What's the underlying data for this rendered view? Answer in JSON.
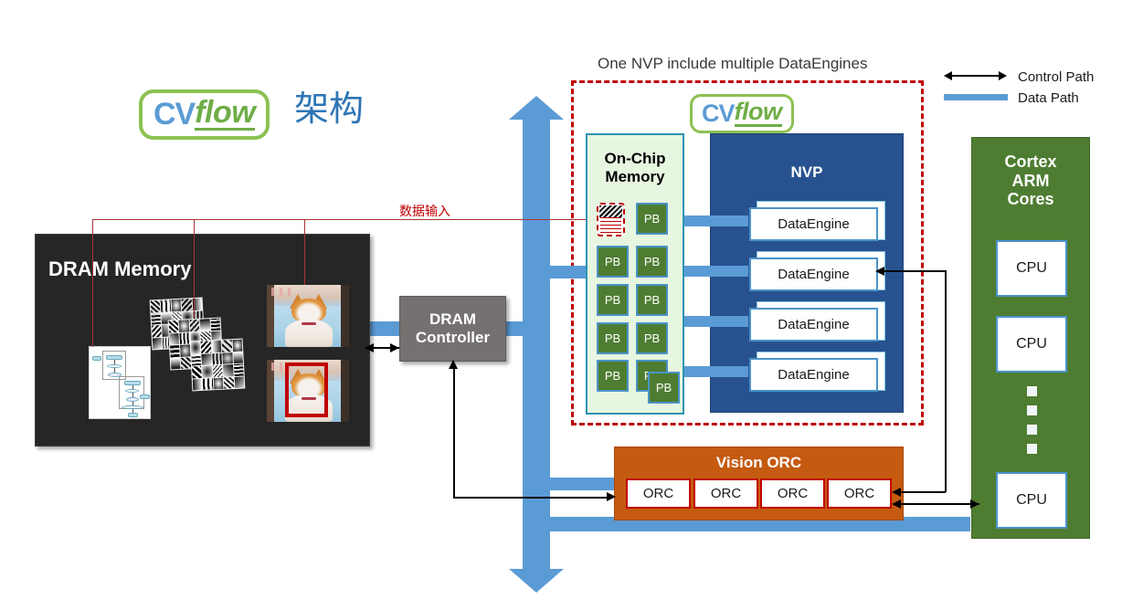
{
  "header": {
    "logo": {
      "cv": "CV",
      "flow": "flow"
    },
    "title_cn": "架构",
    "caption": "One NVP include multiple DataEngines"
  },
  "legend": {
    "control_path": "Control Path",
    "data_path": "Data Path",
    "control_color": "#000000",
    "data_color": "#5b9bd5"
  },
  "dram": {
    "title": "DRAM Memory",
    "bg_color": "#262626",
    "items": [
      "network-graph-thumbnail",
      "feature-map-thumbnails",
      "cat-photo",
      "cat-photo-with-detection-box"
    ]
  },
  "annotation": {
    "data_input": "数据输入",
    "color": "#c00000"
  },
  "dram_controller": {
    "line1": "DRAM",
    "line2": "Controller",
    "bg_color": "#767171"
  },
  "nvp_region": {
    "logo": {
      "cv": "CV",
      "flow": "flow"
    },
    "border_color": "#c00000"
  },
  "on_chip_memory": {
    "title_line1": "On-Chip",
    "title_line2": "Memory",
    "bg_color": "#e7f6e0",
    "border_color": "#2e93b5",
    "pb_label": "PB",
    "pb_color": "#4e7d32",
    "pb_blocks": [
      {
        "label": "doc",
        "special": true
      },
      {
        "label": "PB"
      },
      {
        "label": "PB"
      },
      {
        "label": "PB"
      },
      {
        "label": "PB"
      },
      {
        "label": "PB"
      },
      {
        "label": "PB"
      },
      {
        "label": "PB"
      },
      {
        "label": "PB"
      },
      {
        "label": "PB"
      },
      {
        "label": "PB"
      }
    ]
  },
  "nvp": {
    "title": "NVP",
    "bg_color": "#27528f",
    "engines": [
      "DataEngine",
      "DataEngine",
      "DataEngine",
      "DataEngine"
    ]
  },
  "vision_orc": {
    "title": "Vision ORC",
    "bg_color": "#c55a11",
    "units": [
      "ORC",
      "ORC",
      "ORC",
      "ORC"
    ]
  },
  "cortex": {
    "title_line1": "Cortex",
    "title_line2": "ARM",
    "title_line3": "Cores",
    "bg_color": "#4e7d32",
    "cpus": [
      "CPU",
      "CPU",
      "CPU"
    ],
    "ellipsis_dots": 4
  }
}
